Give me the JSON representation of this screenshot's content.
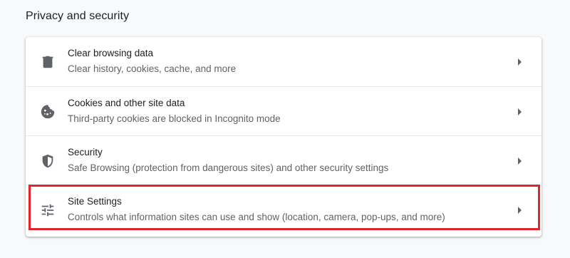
{
  "section": {
    "title": "Privacy and security"
  },
  "items": [
    {
      "title": "Clear browsing data",
      "subtitle": "Clear history, cookies, cache, and more",
      "icon": "trash-icon"
    },
    {
      "title": "Cookies and other site data",
      "subtitle": "Third-party cookies are blocked in Incognito mode",
      "icon": "cookie-icon"
    },
    {
      "title": "Security",
      "subtitle": "Safe Browsing (protection from dangerous sites) and other security settings",
      "icon": "shield-icon"
    },
    {
      "title": "Site Settings",
      "subtitle": "Controls what information sites can use and show (location, camera, pop-ups, and more)",
      "icon": "tune-sliders-icon",
      "highlighted": true
    }
  ],
  "colors": {
    "highlight_border": "#e0252b",
    "icon": "#5f6368",
    "title_text": "#202124",
    "subtitle_text": "#5f6368"
  }
}
